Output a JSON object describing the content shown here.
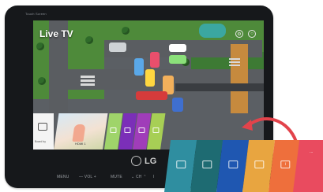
{
  "device": {
    "model_label": "Touch Screen",
    "brand": "LG",
    "controls": {
      "menu": "MENU",
      "vol": "— VOL +",
      "mute": "MUTE",
      "ch": "⌄ CH ⌃",
      "extra": "I"
    }
  },
  "screen": {
    "title": "Live TV",
    "icons": [
      "settings-icon",
      "search-icon"
    ],
    "launcher": {
      "input_label": "Board by",
      "preview_caption": "HDMI 1",
      "tiles": [
        {
          "color": "#9fd46a",
          "icon": "app-icon"
        },
        {
          "color": "#7b2fb8",
          "icon": "app-icon"
        },
        {
          "color": "#a03db9",
          "icon": "photo-icon"
        },
        {
          "color": "#a7cf55",
          "icon": "app-icon"
        }
      ]
    }
  },
  "overlay": {
    "tiles": [
      {
        "color": "#2f8ea0",
        "icon": "screen-share-icon"
      },
      {
        "color": "#1e6b72",
        "icon": "music-icon"
      },
      {
        "color": "#1f57b1",
        "icon": "photo-icon"
      },
      {
        "color": "#e8a540",
        "icon": "gallery-icon"
      },
      {
        "color": "#ee6f3c",
        "icon": "info-icon"
      },
      {
        "color": "#e94b5f",
        "icon": "more-icon",
        "text": "..."
      }
    ]
  }
}
